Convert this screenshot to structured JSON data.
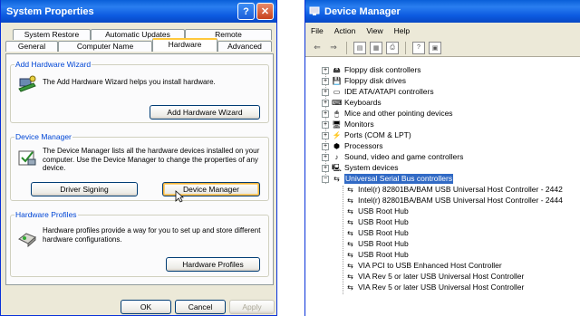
{
  "sysprops": {
    "title": "System Properties",
    "tabs_row1": [
      "System Restore",
      "Automatic Updates",
      "Remote"
    ],
    "tabs_row2": [
      "General",
      "Computer Name",
      "Hardware",
      "Advanced"
    ],
    "add_hw": {
      "legend": "Add Hardware Wizard",
      "text": "The Add Hardware Wizard helps you install hardware.",
      "button": "Add Hardware Wizard"
    },
    "devmgr": {
      "legend": "Device Manager",
      "text": "The Device Manager lists all the hardware devices installed on your computer. Use the Device Manager to change the properties of any device.",
      "btn_signing": "Driver Signing",
      "btn_devmgr": "Device Manager"
    },
    "profiles": {
      "legend": "Hardware Profiles",
      "text": "Hardware profiles provide a way for you to set up and store different hardware configurations.",
      "button": "Hardware Profiles"
    },
    "ok": "OK",
    "cancel": "Cancel",
    "apply": "Apply"
  },
  "devmgr": {
    "title": "Device Manager",
    "menu": [
      "File",
      "Action",
      "View",
      "Help"
    ],
    "tree": [
      "Floppy disk controllers",
      "Floppy disk drives",
      "IDE ATA/ATAPI controllers",
      "Keyboards",
      "Mice and other pointing devices",
      "Monitors",
      "Ports (COM & LPT)",
      "Processors",
      "Sound, video and game controllers",
      "System devices",
      "Universal Serial Bus controllers"
    ],
    "usb_children": [
      "Intel(r) 82801BA/BAM USB Universal Host Controller - 2442",
      "Intel(r) 82801BA/BAM USB Universal Host Controller - 2444",
      "USB Root Hub",
      "USB Root Hub",
      "USB Root Hub",
      "USB Root Hub",
      "USB Root Hub",
      "VIA PCI to USB Enhanced Host Controller",
      "VIA Rev 5 or later USB Universal Host Controller",
      "VIA Rev 5 or later USB Universal Host Controller"
    ]
  }
}
